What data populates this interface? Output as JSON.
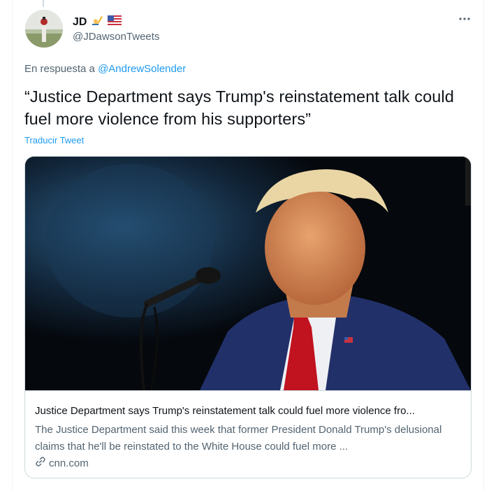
{
  "author": {
    "display_name": "JD",
    "handle": "@JDawsonTweets"
  },
  "reply": {
    "prefix": "En respuesta a",
    "mention": "@AndrewSolender"
  },
  "tweet": {
    "text": "“Justice Department says Trump's reinstatement talk could fuel more violence from his supporters”",
    "translate_label": "Traducir Tweet"
  },
  "card": {
    "title": "Justice Department says Trump's reinstatement talk could fuel more violence fro...",
    "description": "The Justice Department said this week that former President Donald Trump's delusional claims that he'll be reinstated to the White House could fuel more ...",
    "source": "cnn.com"
  },
  "icons": {
    "writing_hand": "writing-hand-icon",
    "flag": "us-flag-icon",
    "more": "more-icon",
    "link": "link-icon"
  },
  "colors": {
    "accent": "#1d9bf0",
    "secondary_text": "#536471",
    "primary_text": "#0f1419",
    "border": "#cfd9de"
  }
}
